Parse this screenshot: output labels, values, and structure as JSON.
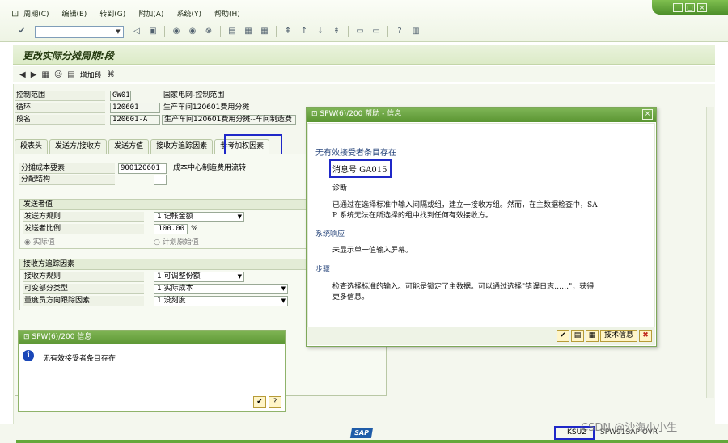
{
  "menu": {
    "items": [
      "周期(C)",
      "编辑(E)",
      "转到(G)",
      "附加(A)",
      "系统(Y)",
      "帮助(H)"
    ]
  },
  "page": {
    "title": "更改实际分摊周期:段"
  },
  "app_toolbar": {
    "add_segment_label": "增加段"
  },
  "header_fields": [
    {
      "label": "控制范围",
      "value": "GW01",
      "desc": "国家电网-控制范围"
    },
    {
      "label": "循环",
      "value": "120601",
      "desc": "生产车间120601费用分摊"
    },
    {
      "label": "段名",
      "value": "120601-A",
      "desc": "生产车间120601费用分摊--车间制造费"
    }
  ],
  "tabs": [
    "段表头",
    "发送方/接收方",
    "发送方值",
    "接收方追踪因素",
    "参考加权因素"
  ],
  "tab_panel": {
    "alloc_cost_elem_label": "分摊成本要素",
    "alloc_cost_elem_value": "900120601",
    "alloc_cost_elem_desc": "成本中心制造费用流转",
    "alloc_struct_label": "分配结构",
    "sender_group": {
      "title": "发送者值",
      "rule_label": "发送方规则",
      "rule_value": "1 记帐金额",
      "share_label": "发送者比例",
      "share_value": "100.00",
      "share_unit": "%",
      "actual_label": "实际值",
      "plan_label": "计划原始值"
    },
    "receiver_group": {
      "title": "接收方追踪因素",
      "rule_label": "接收方规则",
      "rule_value": "1 可调整份额",
      "var_label": "可变部分类型",
      "var_value": "1 实际成本",
      "scale_label": "量度员方向跟踪因素",
      "scale_value": "1 没刻度"
    }
  },
  "info_dialog": {
    "title": "SPW(6)/200 信息",
    "message": "无有效接受者条目存在"
  },
  "help_dialog": {
    "title": "SPW(6)/200 帮助 - 信息",
    "heading": "无有效接受者条目存在",
    "message_no": "消息号 GA015",
    "diagnosis_label": "诊断",
    "diagnosis_text_1": "已通过在选择标准中输入间隔或组，建立一接收方组。然而，在主数据检查中，SA",
    "diagnosis_text_2": "P 系统无法在所选择的组中找到任何有效接收方。",
    "system_response_label": "系统响应",
    "system_response_text": "未显示单一值输入屏幕。",
    "procedure_label": "步骤",
    "procedure_text_1": "检查选择标准的输入。可能是锁定了主数据。可以通过选择\"错误日志……\"，获得",
    "procedure_text_2": "更多信息。",
    "tech_info_label": "技术信息"
  },
  "status_bar": {
    "system": "KSU2",
    "server": "SPW91SAP",
    "mode": "OVR",
    "logo": "SAP",
    "watermark": "CSDN @沙海小小生"
  },
  "colors": {
    "accent_green": "#5a9532",
    "highlight_blue": "#1f28c8",
    "help_heading": "#27457b"
  }
}
